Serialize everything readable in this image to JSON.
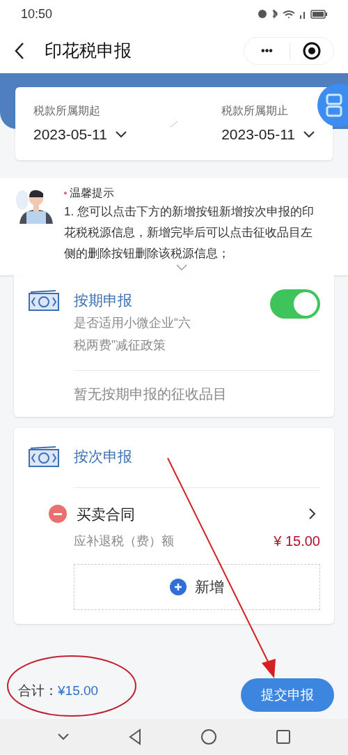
{
  "status_bar": {
    "time": "10:50"
  },
  "nav": {
    "title": "印花税申报",
    "more": "•••"
  },
  "period": {
    "start_label": "税款所属期起",
    "start_value": "2023-05-11",
    "end_label": "税款所属期止",
    "end_value": "2023-05-11"
  },
  "tip": {
    "title": "温馨提示",
    "text": "1. 您可以点击下方的新增按钮新增按次申报的印花税税源信息，新增完毕后可以点击征收品目左侧的删除按钮删除该税源信息；",
    "expanded": false
  },
  "periodic": {
    "title": "按期申报",
    "policy": "是否适用小微企业“六税两费”减征政策",
    "on": true,
    "empty": "暂无按期申报的征收品目"
  },
  "per_time": {
    "title": "按次申报",
    "items": [
      {
        "name": "买卖合同",
        "amount_label": "应补退税（费）额",
        "amount": "¥ 15.00"
      }
    ],
    "add": "新增"
  },
  "footer": {
    "total_label": "合计：",
    "total": "¥15.00",
    "submit": "提交申报"
  }
}
